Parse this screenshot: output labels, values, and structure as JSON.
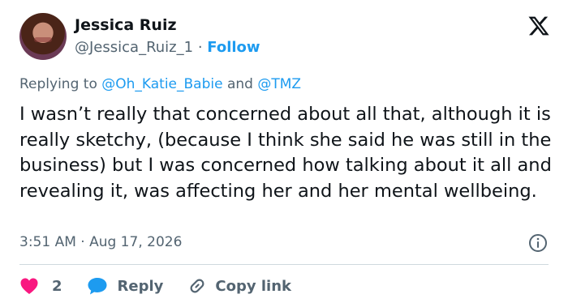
{
  "author": {
    "name": "Jessica Ruiz",
    "handle": "@Jessica_Ruiz_1",
    "separator": "·",
    "follow_label": "Follow"
  },
  "reply_context": {
    "prefix": "Replying to",
    "mention_1": "@Oh_Katie_Babie",
    "conjunction": "and",
    "mention_2": "@TMZ"
  },
  "tweet": {
    "text": "I wasn’t really that concerned about all that, although it is really sketchy, (because I think she said he was still in the business) but I was concerned how talking about it all and revealing it, was affecting her and her mental wellbeing."
  },
  "meta": {
    "time": "3:51 AM · Aug 17, 2026"
  },
  "actions": {
    "like_count": "2",
    "reply_label": "Reply",
    "copy_label": "Copy link"
  },
  "icons": {
    "logo": "x-logo-icon",
    "info": "info-icon",
    "like": "heart-icon",
    "reply": "speech-bubble-icon",
    "copy": "link-icon"
  },
  "colors": {
    "accent": "#1d9bf0",
    "text": "#0f1419",
    "secondary": "#536471",
    "like": "#f91880"
  }
}
